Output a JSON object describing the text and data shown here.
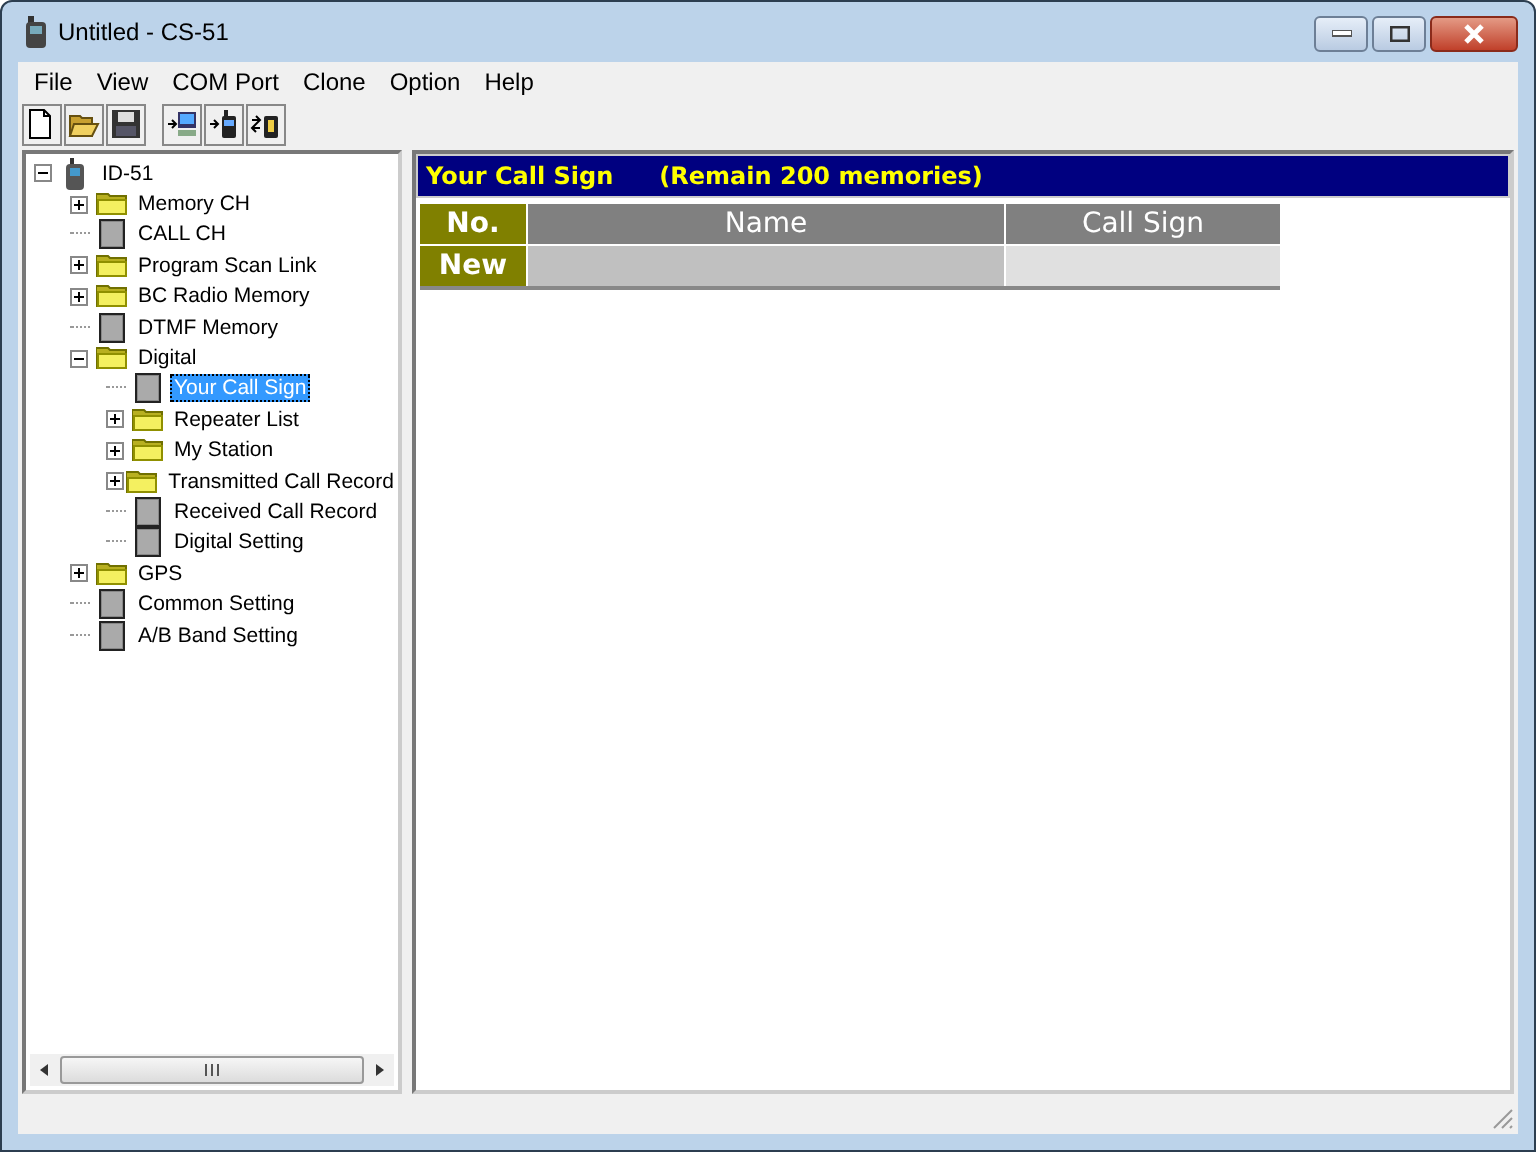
{
  "window": {
    "title": "Untitled - CS-51"
  },
  "menu": [
    "File",
    "View",
    "COM Port",
    "Clone",
    "Option",
    "Help"
  ],
  "toolbar": [
    {
      "kind": "new"
    },
    {
      "kind": "open"
    },
    {
      "kind": "save"
    },
    {
      "kind": "pc"
    },
    {
      "kind": "radio"
    },
    {
      "kind": "radio-query"
    }
  ],
  "tree": [
    {
      "label": "ID-51",
      "kind": "device",
      "expanded": true,
      "selected": false,
      "children": [
        {
          "label": "Memory CH",
          "kind": "folder",
          "expanded": false,
          "selected": false
        },
        {
          "label": "CALL CH",
          "kind": "doc",
          "selected": false
        },
        {
          "label": "Program Scan Link",
          "kind": "folder",
          "expanded": false,
          "selected": false
        },
        {
          "label": "BC Radio Memory",
          "kind": "folder",
          "expanded": false,
          "selected": false
        },
        {
          "label": "DTMF Memory",
          "kind": "doc",
          "selected": false
        },
        {
          "label": "Digital",
          "kind": "folder",
          "expanded": true,
          "selected": false,
          "children": [
            {
              "label": "Your Call Sign",
              "kind": "doc",
              "selected": true
            },
            {
              "label": "Repeater List",
              "kind": "folder",
              "expanded": false,
              "selected": false
            },
            {
              "label": "My Station",
              "kind": "folder",
              "expanded": false,
              "selected": false
            },
            {
              "label": "Transmitted Call Record",
              "kind": "folder",
              "expanded": false,
              "selected": false
            },
            {
              "label": "Received Call Record",
              "kind": "doc",
              "selected": false
            },
            {
              "label": "Digital Setting",
              "kind": "doc",
              "selected": false
            }
          ]
        },
        {
          "label": "GPS",
          "kind": "folder",
          "expanded": false,
          "selected": false
        },
        {
          "label": "Common Setting",
          "kind": "doc",
          "selected": false
        },
        {
          "label": "A/B Band Setting",
          "kind": "doc",
          "selected": false
        }
      ]
    }
  ],
  "panel": {
    "title": "Your Call Sign",
    "remain": "(Remain 200 memories)"
  },
  "table": {
    "columns": [
      "No.",
      "Name",
      "Call Sign"
    ],
    "rows": [
      [
        "New",
        "",
        ""
      ]
    ]
  }
}
